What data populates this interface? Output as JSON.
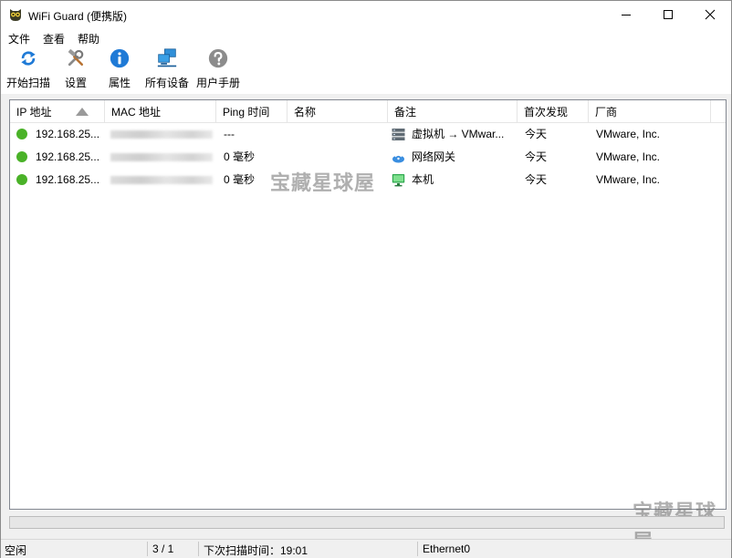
{
  "window": {
    "title": "WiFi Guard (便携版)",
    "app_icon": "owl-icon"
  },
  "menu": [
    "文件",
    "查看",
    "帮助"
  ],
  "toolbar": [
    {
      "label": "开始扫描",
      "icon": "refresh-scan-icon"
    },
    {
      "label": "设置",
      "icon": "tools-icon"
    },
    {
      "label": "属性",
      "icon": "info-icon"
    },
    {
      "label": "所有设备",
      "icon": "network-devices-icon"
    },
    {
      "label": "用户手册",
      "icon": "help-icon"
    }
  ],
  "table": {
    "columns": [
      "IP 地址",
      "MAC 地址",
      "Ping 时间",
      "名称",
      "备注",
      "首次发现",
      "厂商"
    ],
    "sorted_by": "IP 地址",
    "sort_direction": "ascending",
    "rows": [
      {
        "status": "online",
        "ip": "192.168.25...",
        "mac": "",
        "ping": "---",
        "name": "",
        "note_icon": "server-icon",
        "note": "虚拟机 → VMwar...",
        "first_seen": "今天",
        "vendor": "VMware, Inc."
      },
      {
        "status": "online",
        "ip": "192.168.25...",
        "mac": "",
        "ping": "0 毫秒",
        "name": "",
        "note_icon": "wifi-router-icon",
        "note": "网络网关",
        "first_seen": "今天",
        "vendor": "VMware, Inc."
      },
      {
        "status": "online",
        "ip": "192.168.25...",
        "mac": "",
        "ping": "0 毫秒",
        "name": "",
        "note_icon": "monitor-icon",
        "note": "本机",
        "first_seen": "今天",
        "vendor": "VMware, Inc."
      }
    ]
  },
  "watermark": "宝藏星球屋",
  "progress": 0,
  "status": {
    "state": "空闲",
    "count": "3 / 1",
    "next_scan": "下次扫描时间：19:01",
    "adapter": "Ethernet0"
  },
  "colors": {
    "online_dot": "#4ab228",
    "accent_blue": "#1f7ad6"
  }
}
